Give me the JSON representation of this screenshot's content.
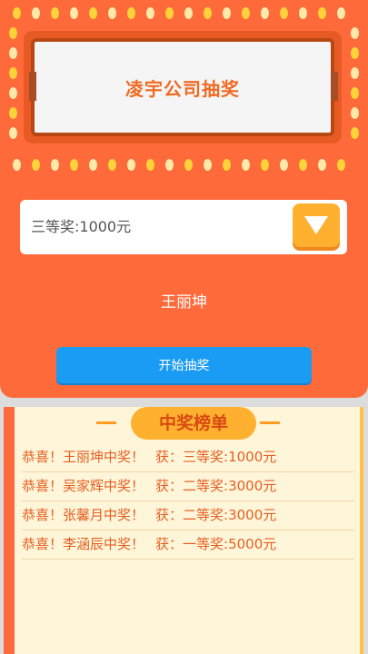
{
  "header": {
    "title": "凌宇公司抽奖"
  },
  "prize_select": {
    "selected": "三等奖:1000元",
    "dropdown_icon": "triangle-down-icon"
  },
  "current_winner": "王丽坤",
  "start_button": {
    "label": "开始抽奖"
  },
  "board": {
    "title": "中奖榜单",
    "entries": [
      {
        "congrats": "恭喜！王丽坤中奖！",
        "prize": "获：三等奖:1000元"
      },
      {
        "congrats": "恭喜！吴家辉中奖！",
        "prize": "获：二等奖:3000元"
      },
      {
        "congrats": "恭喜！张馨月中奖！",
        "prize": "获：二等奖:3000元"
      },
      {
        "congrats": "恭喜！李涵辰中奖！",
        "prize": "获：一等奖:5000元"
      }
    ]
  },
  "colors": {
    "panel": "#ff6a3b",
    "accent": "#ffb02e",
    "button": "#1a9cf5",
    "board_bg": "#fff6da"
  }
}
